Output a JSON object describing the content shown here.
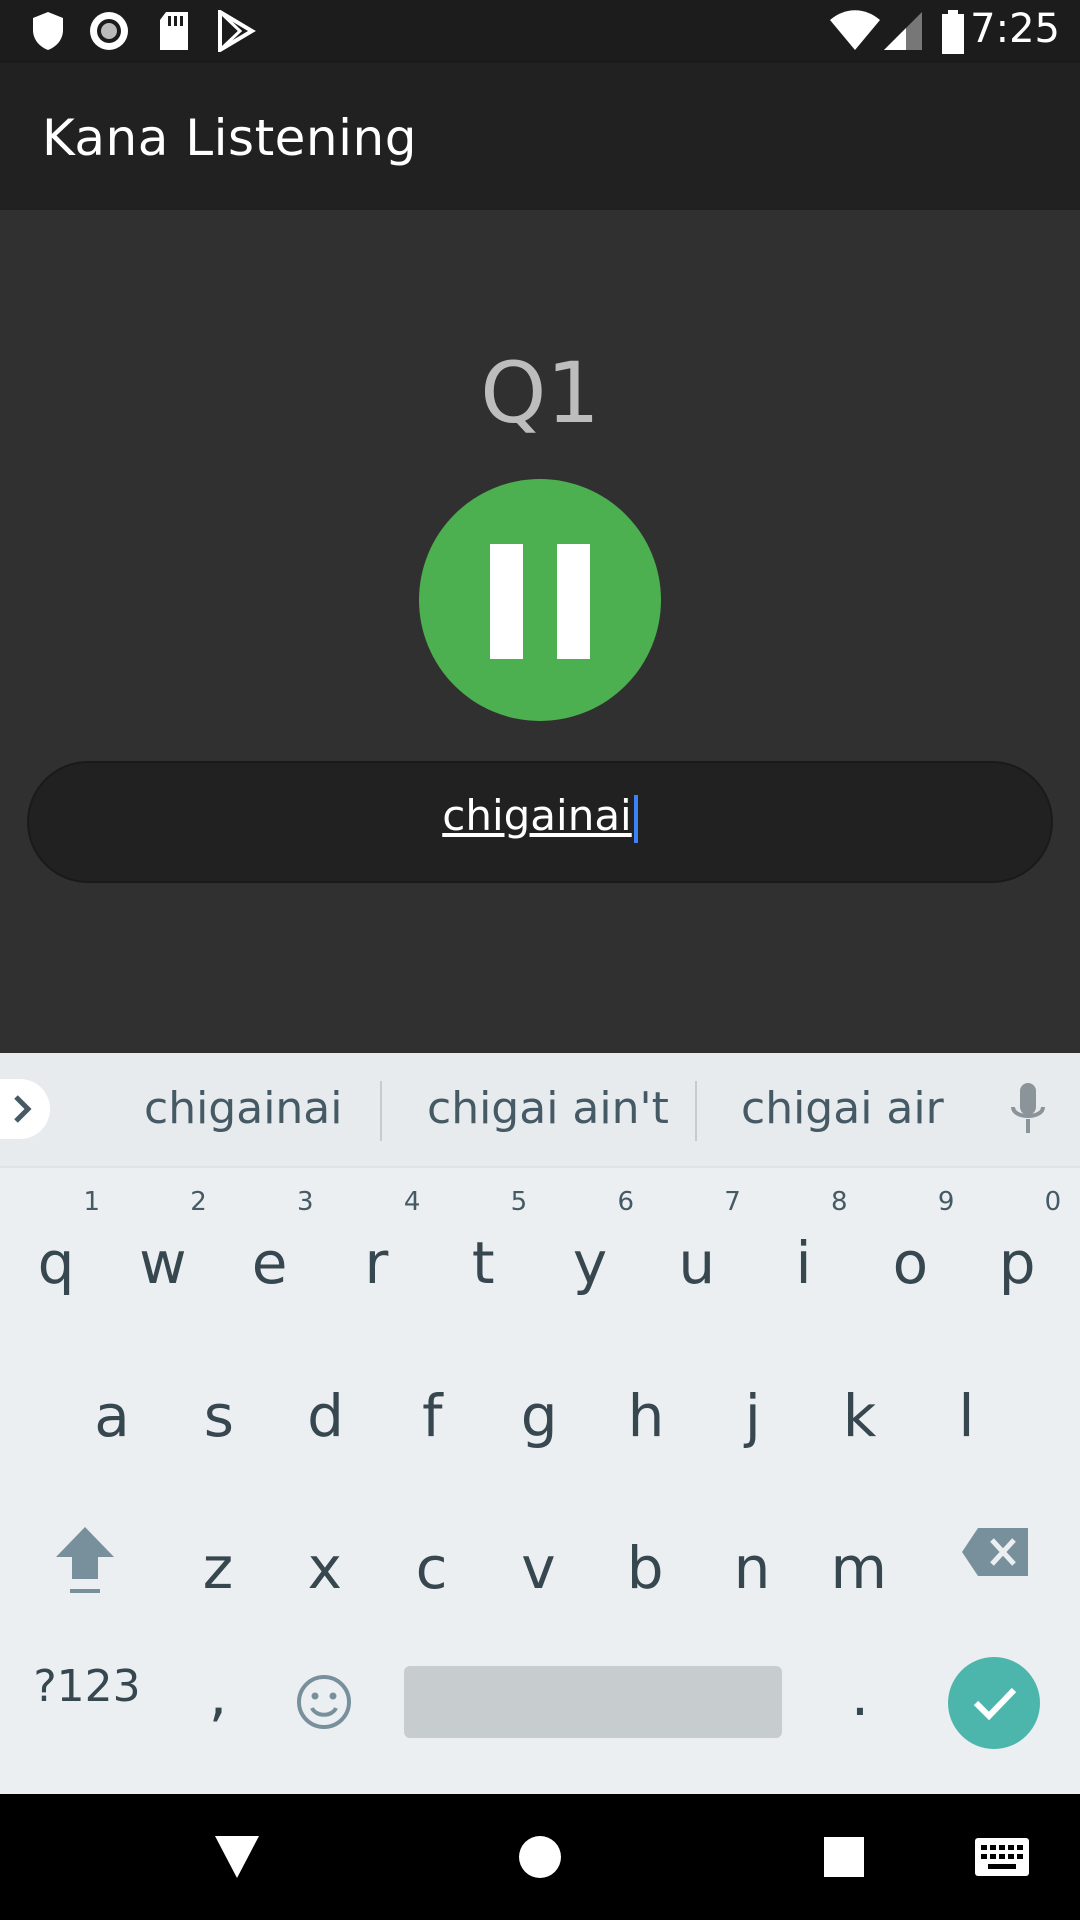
{
  "status_bar": {
    "time": "7:25",
    "left_icons": [
      "shield-icon",
      "circle-record-icon",
      "sd-card-icon",
      "play-store-icon"
    ],
    "right_icons": [
      "wifi-icon",
      "cell-signal-icon",
      "battery-icon"
    ]
  },
  "app_bar": {
    "title": "Kana Listening"
  },
  "quiz": {
    "question_label": "Q1",
    "play_button_icon": "pause-icon",
    "answer_value": "chigainai"
  },
  "keyboard": {
    "suggestions": [
      "chigainai",
      "chigai ain't",
      "chigai air"
    ],
    "row1": [
      {
        "ch": "q",
        "num": "1"
      },
      {
        "ch": "w",
        "num": "2"
      },
      {
        "ch": "e",
        "num": "3"
      },
      {
        "ch": "r",
        "num": "4"
      },
      {
        "ch": "t",
        "num": "5"
      },
      {
        "ch": "y",
        "num": "6"
      },
      {
        "ch": "u",
        "num": "7"
      },
      {
        "ch": "i",
        "num": "8"
      },
      {
        "ch": "o",
        "num": "9"
      },
      {
        "ch": "p",
        "num": "0"
      }
    ],
    "row2": [
      "a",
      "s",
      "d",
      "f",
      "g",
      "h",
      "j",
      "k",
      "l"
    ],
    "row3": [
      "z",
      "x",
      "c",
      "v",
      "b",
      "n",
      "m"
    ],
    "symbols_key": "?123",
    "comma_key": ",",
    "period_key": ".",
    "accent_color": "#4db6ac"
  },
  "nav_bar": {
    "icons": [
      "back-icon",
      "home-icon",
      "recents-icon",
      "keyboard-switch-icon"
    ]
  }
}
